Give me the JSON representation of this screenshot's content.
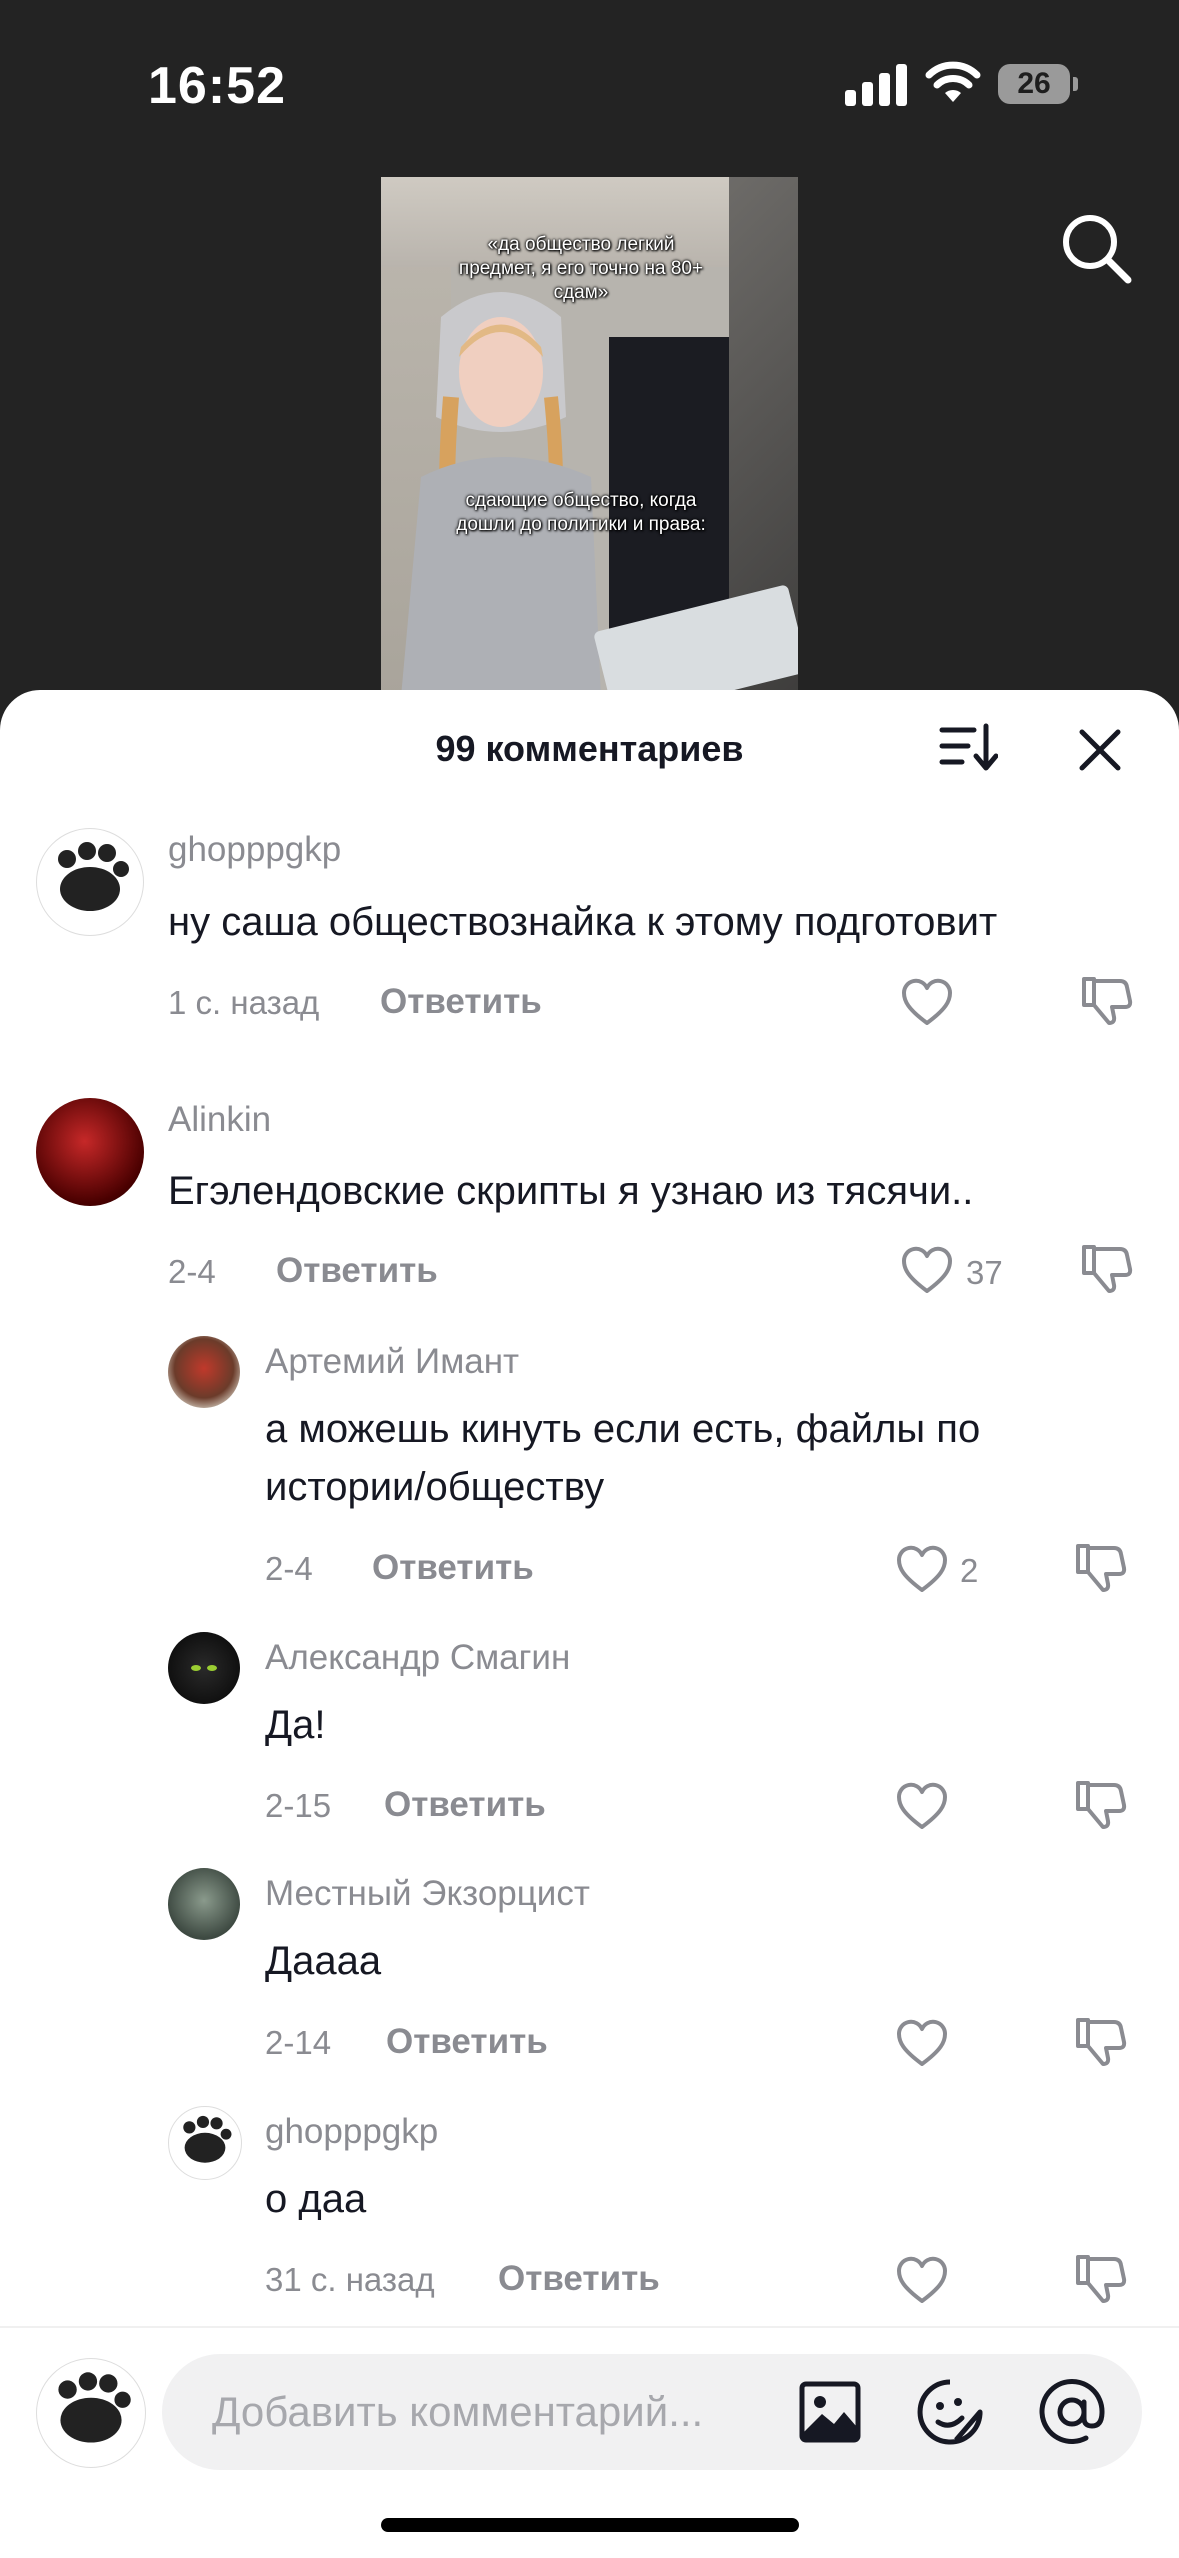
{
  "status": {
    "time": "16:52",
    "battery": "26"
  },
  "video": {
    "caption_top": "«да общество легкий предмет, я его точно на 80+ сдам»",
    "caption_mid": "сдающие общество, когда дошли до политики и права:"
  },
  "sheet": {
    "title": "99 комментариев"
  },
  "comments": [
    {
      "user": "ghopppgkp",
      "text": "ну саша обществознайка к этому подготовит",
      "time": "1 с. назад",
      "reply": "Ответить",
      "likes": ""
    },
    {
      "user": "Alinkin",
      "text": "Егэлендовские скрипты я узнаю из тясячи..",
      "time": "2-4",
      "reply": "Ответить",
      "likes": "37"
    }
  ],
  "replies": [
    {
      "user": "Артемий Имант",
      "text_line1": "а можешь кинуть если есть, файлы по",
      "text_line2": "истории/обществу",
      "time": "2-4",
      "reply": "Ответить",
      "likes": "2"
    },
    {
      "user": "Александр Смагин",
      "text": "Да!",
      "time": "2-15",
      "reply": "Ответить",
      "likes": ""
    },
    {
      "user": "Местный Экзорцист",
      "text": "Даааа",
      "time": "2-14",
      "reply": "Ответить",
      "likes": ""
    },
    {
      "user": "ghopppgkp",
      "text": "о даа",
      "time": "31 с. назад",
      "reply": "Ответить",
      "likes": ""
    }
  ],
  "composer": {
    "placeholder": "Добавить комментарий..."
  },
  "colors": {
    "text": "#161823",
    "secondary": "#8a8b91",
    "sheet": "#ffffff",
    "backdrop": "#232323"
  }
}
